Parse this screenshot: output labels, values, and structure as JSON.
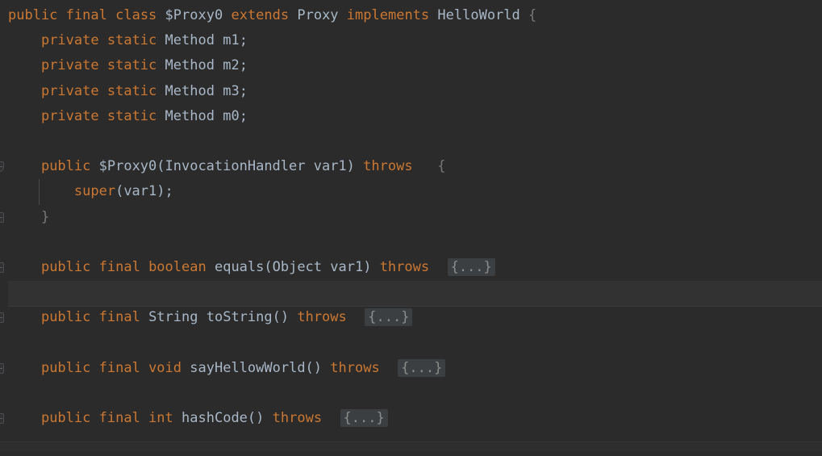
{
  "editor": {
    "kind": "decompiled-java-source-view",
    "background_color": "#2b2b2b",
    "current_line_highlight_color": "#323232",
    "keyword_color": "#cc7832",
    "identifier_color": "#a9b7c6",
    "fold_placeholder_color": "#8c8c8c",
    "fold_placeholder_background": "#3c3f41",
    "indent_guide_color": "#4b4b4d",
    "fold_placeholder_text": "{...}",
    "current_line_index": 11
  },
  "gutter": {
    "markers": [
      {
        "line": 6,
        "icon": "fold-arrow-icon",
        "label": ""
      },
      {
        "line": 8,
        "icon": "fold-end-icon",
        "label": ""
      },
      {
        "line": 10,
        "icon": "fold-collapsed-icon",
        "label": ""
      },
      {
        "line": 12,
        "icon": "fold-collapsed-icon",
        "label": ""
      },
      {
        "line": 14,
        "icon": "fold-collapsed-icon",
        "label": ""
      },
      {
        "line": 16,
        "icon": "fold-collapsed-icon",
        "label": ""
      }
    ]
  },
  "code": {
    "lines": [
      {
        "index": 0,
        "tokens": [
          {
            "t": "public",
            "c": "kw"
          },
          {
            "t": " ",
            "c": "punct"
          },
          {
            "t": "final",
            "c": "kw"
          },
          {
            "t": " ",
            "c": "punct"
          },
          {
            "t": "class",
            "c": "kw"
          },
          {
            "t": " ",
            "c": "punct"
          },
          {
            "t": "$Proxy0",
            "c": "id"
          },
          {
            "t": " ",
            "c": "punct"
          },
          {
            "t": "extends",
            "c": "kw"
          },
          {
            "t": " ",
            "c": "punct"
          },
          {
            "t": "Proxy",
            "c": "id"
          },
          {
            "t": " ",
            "c": "punct"
          },
          {
            "t": "implements",
            "c": "kw"
          },
          {
            "t": " ",
            "c": "punct"
          },
          {
            "t": "HelloWorld",
            "c": "id"
          },
          {
            "t": " ",
            "c": "punct"
          },
          {
            "t": "{",
            "c": "dim"
          }
        ]
      },
      {
        "index": 1,
        "tokens": [
          {
            "t": "    ",
            "c": "punct"
          },
          {
            "t": "private",
            "c": "kw"
          },
          {
            "t": " ",
            "c": "punct"
          },
          {
            "t": "static",
            "c": "kw"
          },
          {
            "t": " ",
            "c": "punct"
          },
          {
            "t": "Method",
            "c": "id"
          },
          {
            "t": " ",
            "c": "punct"
          },
          {
            "t": "m1",
            "c": "id"
          },
          {
            "t": ";",
            "c": "punct"
          }
        ]
      },
      {
        "index": 2,
        "tokens": [
          {
            "t": "    ",
            "c": "punct"
          },
          {
            "t": "private",
            "c": "kw"
          },
          {
            "t": " ",
            "c": "punct"
          },
          {
            "t": "static",
            "c": "kw"
          },
          {
            "t": " ",
            "c": "punct"
          },
          {
            "t": "Method",
            "c": "id"
          },
          {
            "t": " ",
            "c": "punct"
          },
          {
            "t": "m2",
            "c": "id"
          },
          {
            "t": ";",
            "c": "punct"
          }
        ]
      },
      {
        "index": 3,
        "tokens": [
          {
            "t": "    ",
            "c": "punct"
          },
          {
            "t": "private",
            "c": "kw"
          },
          {
            "t": " ",
            "c": "punct"
          },
          {
            "t": "static",
            "c": "kw"
          },
          {
            "t": " ",
            "c": "punct"
          },
          {
            "t": "Method",
            "c": "id"
          },
          {
            "t": " ",
            "c": "punct"
          },
          {
            "t": "m3",
            "c": "id"
          },
          {
            "t": ";",
            "c": "punct"
          }
        ]
      },
      {
        "index": 4,
        "tokens": [
          {
            "t": "    ",
            "c": "punct"
          },
          {
            "t": "private",
            "c": "kw"
          },
          {
            "t": " ",
            "c": "punct"
          },
          {
            "t": "static",
            "c": "kw"
          },
          {
            "t": " ",
            "c": "punct"
          },
          {
            "t": "Method",
            "c": "id"
          },
          {
            "t": " ",
            "c": "punct"
          },
          {
            "t": "m0",
            "c": "id"
          },
          {
            "t": ";",
            "c": "punct"
          }
        ]
      },
      {
        "index": 5,
        "tokens": []
      },
      {
        "index": 6,
        "tokens": [
          {
            "t": "    ",
            "c": "punct"
          },
          {
            "t": "public",
            "c": "kw"
          },
          {
            "t": " ",
            "c": "punct"
          },
          {
            "t": "$Proxy0(InvocationHandler var1)",
            "c": "id"
          },
          {
            "t": " ",
            "c": "punct"
          },
          {
            "t": "throws",
            "c": "kw"
          },
          {
            "t": "   ",
            "c": "punct"
          },
          {
            "t": "{",
            "c": "dim"
          }
        ]
      },
      {
        "index": 7,
        "indent_guide": true,
        "tokens": [
          {
            "t": "        ",
            "c": "punct"
          },
          {
            "t": "super",
            "c": "kw"
          },
          {
            "t": "(var1)",
            "c": "id"
          },
          {
            "t": ";",
            "c": "punct"
          }
        ]
      },
      {
        "index": 8,
        "tokens": [
          {
            "t": "    ",
            "c": "punct"
          },
          {
            "t": "}",
            "c": "dim"
          }
        ]
      },
      {
        "index": 9,
        "tokens": []
      },
      {
        "index": 10,
        "tokens": [
          {
            "t": "    ",
            "c": "punct"
          },
          {
            "t": "public",
            "c": "kw"
          },
          {
            "t": " ",
            "c": "punct"
          },
          {
            "t": "final",
            "c": "kw"
          },
          {
            "t": " ",
            "c": "punct"
          },
          {
            "t": "boolean",
            "c": "kw"
          },
          {
            "t": " ",
            "c": "punct"
          },
          {
            "t": "equals(Object var1)",
            "c": "id"
          },
          {
            "t": " ",
            "c": "punct"
          },
          {
            "t": "throws",
            "c": "kw"
          },
          {
            "t": "  ",
            "c": "punct"
          },
          {
            "t": "{...}",
            "c": "fold"
          }
        ]
      },
      {
        "index": 11,
        "tokens": []
      },
      {
        "index": 12,
        "tokens": [
          {
            "t": "    ",
            "c": "punct"
          },
          {
            "t": "public",
            "c": "kw"
          },
          {
            "t": " ",
            "c": "punct"
          },
          {
            "t": "final",
            "c": "kw"
          },
          {
            "t": " ",
            "c": "punct"
          },
          {
            "t": "String",
            "c": "id"
          },
          {
            "t": " ",
            "c": "punct"
          },
          {
            "t": "toString()",
            "c": "id"
          },
          {
            "t": " ",
            "c": "punct"
          },
          {
            "t": "throws",
            "c": "kw"
          },
          {
            "t": "  ",
            "c": "punct"
          },
          {
            "t": "{...}",
            "c": "fold"
          }
        ]
      },
      {
        "index": 13,
        "tokens": []
      },
      {
        "index": 14,
        "tokens": [
          {
            "t": "    ",
            "c": "punct"
          },
          {
            "t": "public",
            "c": "kw"
          },
          {
            "t": " ",
            "c": "punct"
          },
          {
            "t": "final",
            "c": "kw"
          },
          {
            "t": " ",
            "c": "punct"
          },
          {
            "t": "void",
            "c": "kw"
          },
          {
            "t": " ",
            "c": "punct"
          },
          {
            "t": "sayHellowWorld()",
            "c": "id"
          },
          {
            "t": " ",
            "c": "punct"
          },
          {
            "t": "throws",
            "c": "kw"
          },
          {
            "t": "  ",
            "c": "punct"
          },
          {
            "t": "{...}",
            "c": "fold"
          }
        ]
      },
      {
        "index": 15,
        "tokens": []
      },
      {
        "index": 16,
        "tokens": [
          {
            "t": "    ",
            "c": "punct"
          },
          {
            "t": "public",
            "c": "kw"
          },
          {
            "t": " ",
            "c": "punct"
          },
          {
            "t": "final",
            "c": "kw"
          },
          {
            "t": " ",
            "c": "punct"
          },
          {
            "t": "int",
            "c": "kw"
          },
          {
            "t": " ",
            "c": "punct"
          },
          {
            "t": "hashCode()",
            "c": "id"
          },
          {
            "t": " ",
            "c": "punct"
          },
          {
            "t": "throws",
            "c": "kw"
          },
          {
            "t": "  ",
            "c": "punct"
          },
          {
            "t": "{...}",
            "c": "fold"
          }
        ]
      },
      {
        "index": 17,
        "tokens": []
      }
    ]
  }
}
